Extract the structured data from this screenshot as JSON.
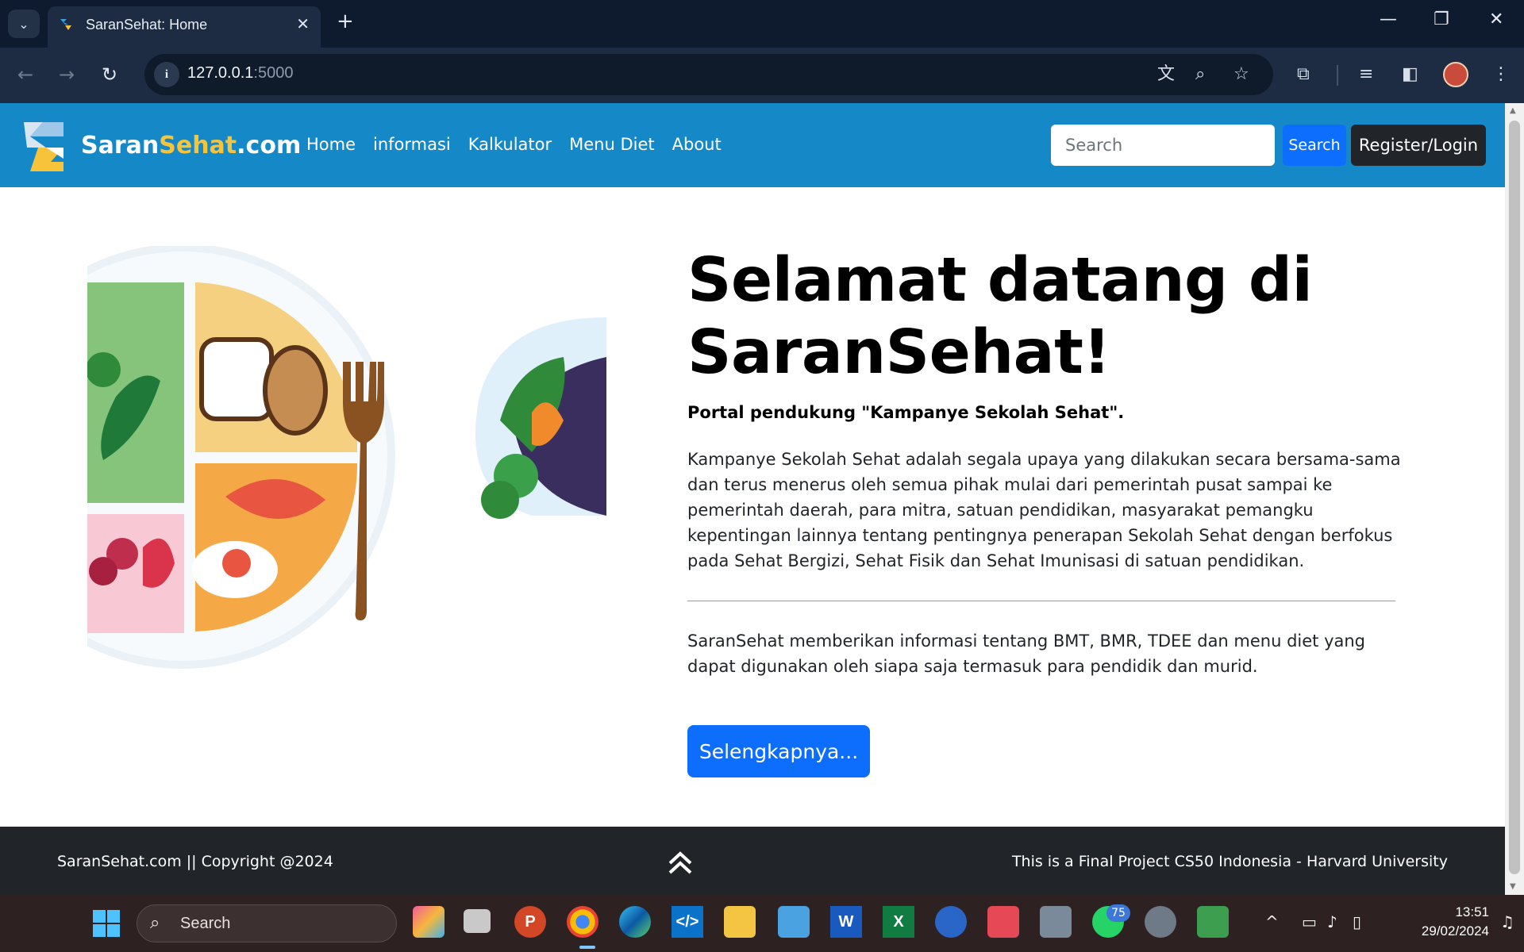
{
  "browser": {
    "tab_title": "SaranSehat: Home",
    "url_host": "127.0.0.1",
    "url_port": ":5000"
  },
  "site": {
    "brand_part1": "Saran",
    "brand_part2": "Sehat",
    "brand_part3": ".com",
    "nav": [
      "Home",
      "informasi",
      "Kalkulator",
      "Menu Diet",
      "About"
    ],
    "search_placeholder": "Search",
    "search_button": "Search",
    "login_button": "Register/Login",
    "accent_color": "#1589c8",
    "brand_accent": "#f6c33b"
  },
  "hero": {
    "title": "Selamat datang di SaranSehat!",
    "lead": "Portal pendukung \"Kampanye Sekolah Sehat\".",
    "paragraph": "Kampanye Sekolah Sehat adalah segala upaya yang dilakukan secara bersama-sama dan terus menerus oleh semua pihak mulai dari pemerintah pusat sampai ke pemerintah daerah, para mitra, satuan pendidikan, masyarakat pemangku kepentingan lainnya tentang pentingnya penerapan Sekolah Sehat dengan berfokus pada Sehat Bergizi, Sehat Fisik dan Sehat Imunisasi di satuan pendidikan.",
    "paragraph2": "SaranSehat memberikan informasi tentang BMT, BMR, TDEE dan menu diet yang dapat digunakan oleh siapa saja termasuk para pendidik dan murid.",
    "cta": "Selengkapnya..."
  },
  "footer": {
    "left": "SaranSehat.com || Copyright @2024",
    "right": "This is a Final Project CS50 Indonesia - Harvard University"
  },
  "taskbar": {
    "search_label": "Search",
    "whatsapp_badge": "75",
    "time": "13:51",
    "date": "29/02/2024"
  }
}
